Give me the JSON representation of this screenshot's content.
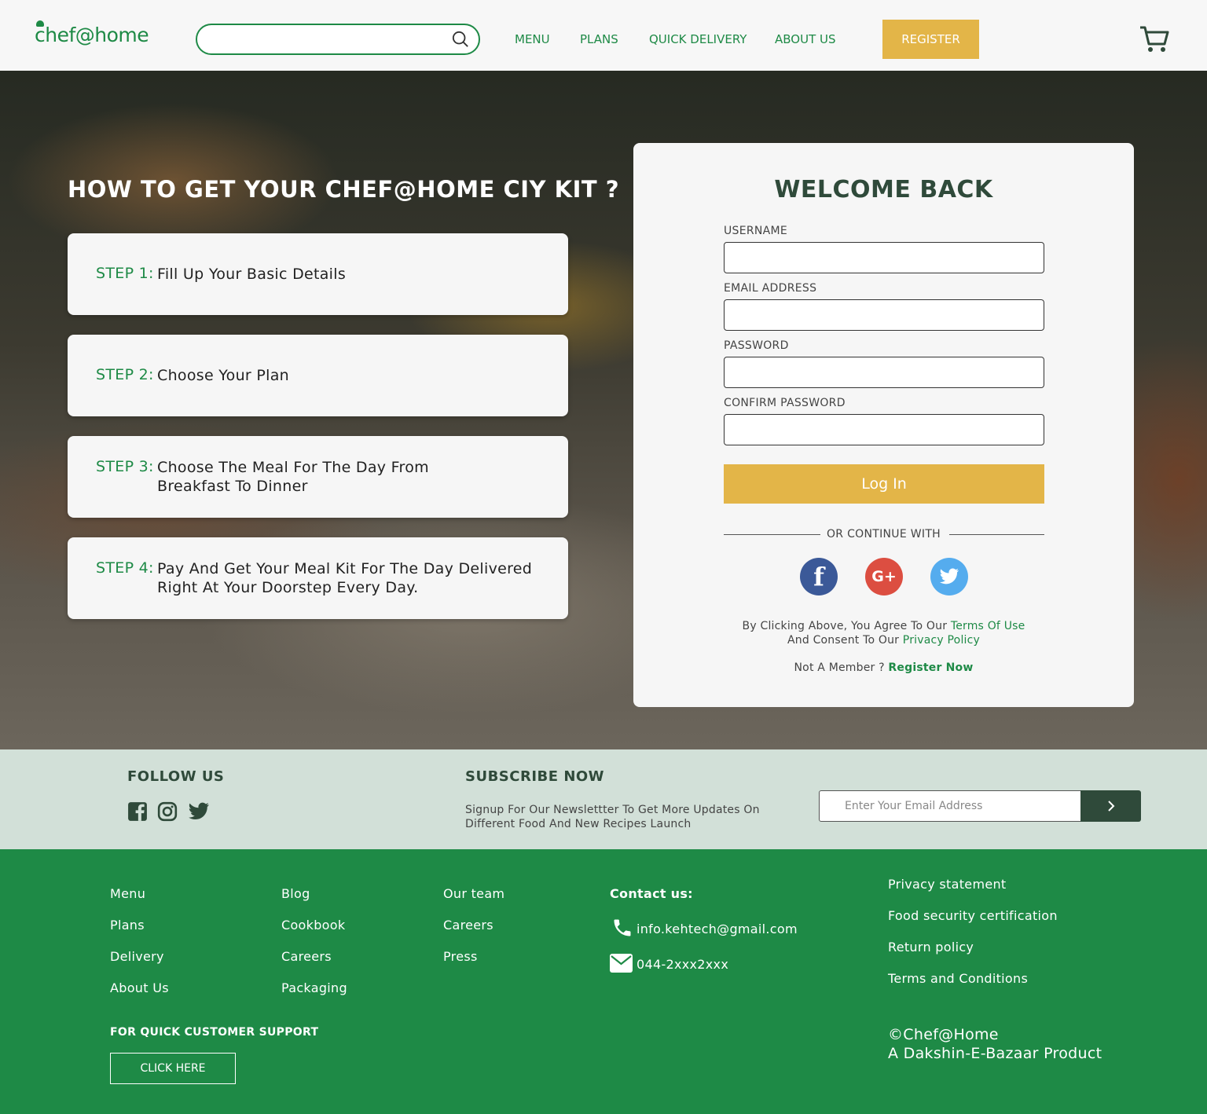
{
  "header": {
    "logo": "chef@home",
    "search_placeholder": "",
    "nav": [
      "MENU",
      "PLANS",
      "QUICK DELIVERY",
      "ABOUT US"
    ],
    "register_label": "REGISTER"
  },
  "hero": {
    "title": "HOW TO GET YOUR CHEF@HOME CIY KIT ?",
    "steps": [
      {
        "num": "STEP 1:",
        "line1": "Fill Up Your Basic Details",
        "line2": ""
      },
      {
        "num": "STEP 2:",
        "line1": "Choose Your Plan",
        "line2": ""
      },
      {
        "num": "STEP 3:",
        "line1": "Choose The Meal For The Day From",
        "line2": "Breakfast To Dinner"
      },
      {
        "num": "STEP 4:",
        "line1": "Pay And Get Your Meal Kit For The Day Delivered",
        "line2": "Right At Your Doorstep Every Day."
      }
    ]
  },
  "login": {
    "title": "WELCOME BACK",
    "fields": [
      {
        "label": "USERNAME",
        "value": ""
      },
      {
        "label": "EMAIL ADDRESS",
        "value": ""
      },
      {
        "label": "PASSWORD",
        "value": ""
      },
      {
        "label": "CONFIRM PASSWORD",
        "value": ""
      }
    ],
    "button": "Log In",
    "or_text": "OR CONTINUE WITH",
    "social": [
      {
        "name": "facebook-icon",
        "glyph": "f",
        "color": "#3b5998"
      },
      {
        "name": "google-plus-icon",
        "glyph": "G+",
        "color": "#dc4e41"
      },
      {
        "name": "twitter-icon",
        "glyph": "",
        "color": "#55acee"
      }
    ],
    "agree_prefix": "By Clicking Above, You Agree To Our ",
    "terms_link": "Terms Of Use",
    "agree_middle": "And Consent To Our ",
    "privacy_link": "Privacy Policy",
    "member_prefix": "Not A Member ? ",
    "register_now": "Register Now"
  },
  "band": {
    "follow_title": "FOLLOW US",
    "subscribe_title": "SUBSCRIBE NOW",
    "subscribe_desc": "Signup For Our Newslettter To Get More Updates On Different Food And New Recipes Launch",
    "email_placeholder": "Enter Your Email Address"
  },
  "footer": {
    "col1": [
      "Menu",
      "Plans",
      "Delivery",
      "About Us"
    ],
    "col2": [
      "Blog",
      "Cookbook",
      "Careers",
      "Packaging"
    ],
    "col3": [
      "Our team",
      "Careers",
      "Press"
    ],
    "contact_title": "Contact us:",
    "contact_email": "info.kehtech@gmail.com",
    "contact_phone": "044-2xxx2xxx",
    "col5": [
      "Privacy statement",
      "Food security certification",
      "Return policy",
      "Terms and Conditions"
    ],
    "support_title": "FOR QUICK CUSTOMER SUPPORT",
    "support_button": "CLICK HERE",
    "copyright": "©Chef@Home",
    "product": "A Dakshin-E-Bazaar Product"
  },
  "colors": {
    "brand_green": "#1e8a46",
    "accent_gold": "#e3b548",
    "dark_green": "#2f4a3a",
    "band_bg": "#d2e0d8"
  }
}
